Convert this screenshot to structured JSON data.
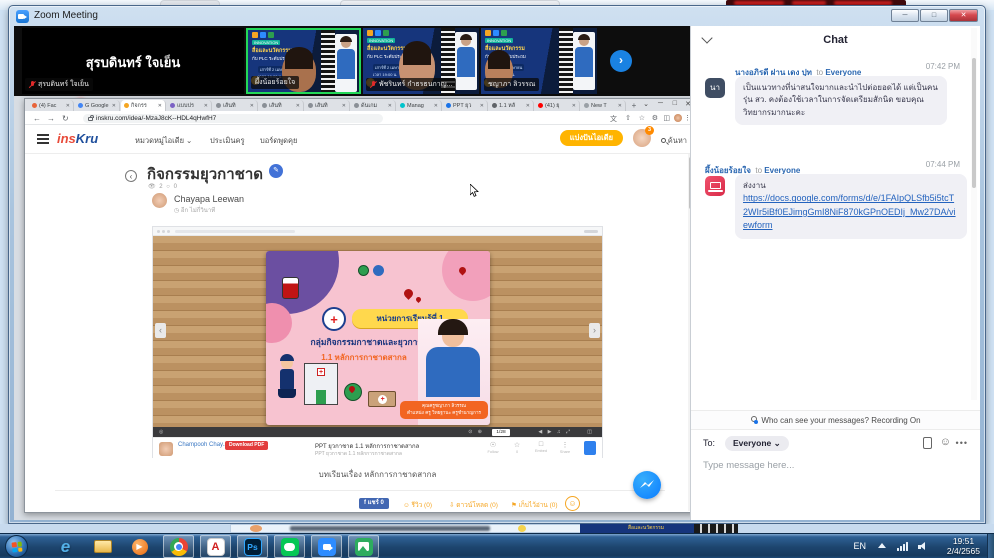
{
  "zoom": {
    "title": "Zoom Meeting",
    "recording_label": "Recording",
    "video": {
      "tiles": [
        {
          "name": "สุรบดินทร์ ใจเย็น"
        },
        {
          "name": "ผึ้งน้อยร้อยใจ"
        },
        {
          "name": "พัชรินทร์ กำธรธนกาญ..."
        },
        {
          "name": "ชญาภา ลิวรรณ"
        }
      ],
      "poster": {
        "badge": "INNOVATION",
        "title": "สื่อและนวัตกรรม",
        "subtitle": "กับ PLC ระดับประถม",
        "date": "เสาร์ที่ 2 เมษายน",
        "time": "เวลา 19:00 น."
      }
    },
    "chat": {
      "title": "Chat",
      "messages": [
        {
          "sender": "นางอภิรดี ฝาน เดง ปุท",
          "to": "to",
          "recipient": "Everyone",
          "time": "07:42 PM",
          "avatar": "นา",
          "text": "เป็นแนวทางที่น่าสนใจมากและนำไปต่อยอดได้ แต่เป็นคนรุ่น สว. คงต้องใช้เวลาในการจัดเตรียมสักนิด ขอบคุณวิทยากรมากนะคะ"
        },
        {
          "sender": "ผึ้งน้อยร้อยใจ",
          "to": "to",
          "recipient": "Everyone",
          "time": "07:44 PM",
          "intro": "ส่งงาน",
          "link": "https://docs.google.com/forms/d/e/1FAIpQLSfb5i5tcT2WIr5iBf0EJimgGmI8NiF870kGPnOEDIj_Mw27DA/viewform"
        }
      ],
      "notice": "Who can see your messages? Recording On",
      "to_label": "To:",
      "to_value": "Everyone",
      "input_placeholder": "Type message here..."
    }
  },
  "browser": {
    "tabs": [
      "(4) Fac",
      "G Google",
      "กิจกรร",
      "แบบปร",
      "เส้นทิ",
      "เส้นทิ",
      "เส้นทิ",
      "ด้นเกม",
      "Manag",
      "PPT ยุว",
      "1.1 หลั",
      "(41) ยุ",
      "New T"
    ],
    "url": "inskru.com/idea/-MzaJ8cK--HDL4qHwfH7",
    "site": {
      "logo_ins": "ins",
      "logo_kru": "Kru",
      "nav": [
        "หมวดหมู่ไอเดีย",
        "ประเมินครู",
        "บอร์ดพูดคุย"
      ],
      "share_button": "แบ่งปันไอเดีย",
      "notif_count": "3",
      "search_label": "ค้นหา"
    },
    "page": {
      "title": "กิจกรรมยุวกาชาด",
      "views": "2",
      "comments": "0",
      "author": "Chayapa Leewan",
      "author_time": "อีก ไม่กี่วินาที",
      "caption": "บทเรียนเรื่อง หลักการกาชาดสากล",
      "share": "แชร์ 0",
      "review": "รีวิว (0)",
      "download": "ดาวน์โหลด (0)",
      "save": "เก็บไว้อ่าน (0)"
    },
    "flipbook": {
      "page_indicator": "1/28",
      "uploader": "Champooh Chay...",
      "download_button": "Download PDF",
      "doc_title": "PPT ยุวกาชาด 1.1 หลักการกาชาดสากล",
      "doc_subtitle": "PPT ยุวกาชาด 1.1 หลักการกาชาดสากล",
      "follow_label": "Follow",
      "embed_label": "Embed",
      "share_label": "Share",
      "slide": {
        "unit": "หน่วยการเรียนรู้ที่ 1",
        "group": "กลุ่มกิจกรรมกาชาดและยุวกาชาด",
        "topic": "1.1 หลักการกาชาดสากล",
        "teacher": "คุณครูชญาภา ลิวรรณ",
        "teacher_position": "ตำแหน่ง ครู วิทยฐานะ ครูชำนาญการ"
      }
    }
  },
  "taskbar": {
    "lang": "EN",
    "time": "19:51",
    "date": "2/4/2565"
  }
}
